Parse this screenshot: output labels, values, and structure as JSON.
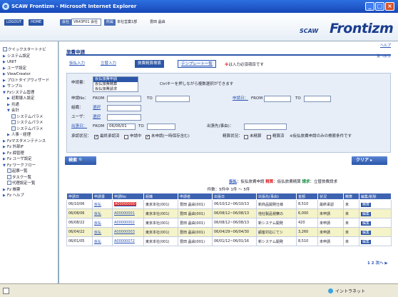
{
  "window": {
    "title": "SCAW Frontizm - Microsoft Internet Explorer",
    "controls": {
      "minimize": "_",
      "maximize": "□",
      "close": "×"
    }
  },
  "app_header": {
    "logo_small": "SCAW",
    "logo_big": "Frontizm",
    "buttons": [
      "LOGOUT",
      "HOME"
    ],
    "company_label": "会社",
    "company_value": "VR43F01 会社",
    "user_tag": "所属",
    "user_text": "本社営業1部",
    "user_name": "豊田 晶由"
  },
  "sidebar": {
    "items": [
      {
        "label": "クイックスタートナビ",
        "level": 1,
        "icon": "doc"
      },
      {
        "label": "システム設定",
        "level": 1,
        "icon": "tri"
      },
      {
        "label": "UNIT",
        "level": 1,
        "icon": "tri"
      },
      {
        "label": "ユーザ設定",
        "level": 1,
        "icon": "tri"
      },
      {
        "label": "ViewCreator",
        "level": 1,
        "icon": "tri"
      },
      {
        "label": "プロトタイプウィザード",
        "level": 1,
        "icon": "tri"
      },
      {
        "label": "サンプル",
        "level": 1,
        "icon": "tri"
      },
      {
        "label": "Fzシステム管理",
        "level": 1,
        "icon": "tri-open"
      },
      {
        "label": "初期導入設定",
        "level": 2,
        "icon": "tri"
      },
      {
        "label": "共通",
        "level": 2,
        "icon": "tri"
      },
      {
        "label": "会計",
        "level": 2,
        "icon": "tri-open"
      },
      {
        "label": "システムパラメ",
        "level": 3,
        "icon": "doc"
      },
      {
        "label": "システムパラメ",
        "level": 3,
        "icon": "doc"
      },
      {
        "label": "システムパラメ",
        "level": 3,
        "icon": "doc"
      },
      {
        "label": "人事・経理",
        "level": 2,
        "icon": "tri"
      },
      {
        "label": "Fzマスタメンテナンス",
        "level": 1,
        "icon": "tri"
      },
      {
        "label": "Fz 外部IF",
        "level": 1,
        "icon": "tri"
      },
      {
        "label": "Fz 締管理",
        "level": 1,
        "icon": "tri"
      },
      {
        "label": "Fz ユーザ設定",
        "level": 1,
        "icon": "tri"
      },
      {
        "label": "Fz ワークフロー",
        "level": 1,
        "icon": "tri-open"
      },
      {
        "label": "起票一覧",
        "level": 2,
        "icon": "doc"
      },
      {
        "label": "タスク一覧",
        "level": 2,
        "icon": "doc"
      },
      {
        "label": "代理設定一覧",
        "level": 2,
        "icon": "doc"
      },
      {
        "label": "Fz 帳票",
        "level": 1,
        "icon": "tri"
      },
      {
        "label": "Fz ヘルプ",
        "level": 1,
        "icon": "tri"
      }
    ]
  },
  "main": {
    "title": "旅費申請",
    "help_link": "ヘルプ",
    "back_link": "一覧へ戻る",
    "tabs": [
      "仮払入力",
      "立替入力",
      "旅費精算検索",
      "テンプレート一覧"
    ],
    "required_note_mark": "※",
    "required_note": "は入力必須項目です",
    "form": {
      "kind_label": "申請書：",
      "kind_options": [
        "仮払旅費申請",
        "仮払旅費精算",
        "仮払旅費請求"
      ],
      "kind_hint": "Ctrlキーを押しながら複数選択ができます",
      "no_label": "申請No：",
      "date_label": "申請日：",
      "from": "FROM",
      "to": "TO",
      "dept_label": "組織：",
      "user_label": "ユーザ：",
      "trip_label": "出張日：",
      "trip_from_value": "06/06/01",
      "purpose_label": "出張先(事由)：",
      "status_label": "承認状況：",
      "status_options": [
        "最終承認済",
        "申請中",
        "未申請(一時保存含む)"
      ],
      "settle_label": "精算状況：",
      "settle_options": [
        "未精算",
        "精算済"
      ],
      "settle_note": "※仮払旅費申請のみの検索条件です",
      "link_btn": "選択"
    },
    "search_button": "検索",
    "clear_button": "クリア",
    "legend": {
      "k1": "仮払",
      "t1": "：仮払旅費申請 ",
      "k2": "精算",
      "t2": "：仮払旅費精算 ",
      "k3": "請求",
      "t3": "：立替旅費請求"
    },
    "count": "件数：5件中 1件 ～ 5件",
    "table": {
      "headers": [
        "申請日",
        "申請書",
        "申請No",
        "組織",
        "申請者",
        "出張日",
        "出張先(事由)",
        "金額",
        "状況",
        "精算",
        "編集/削除"
      ],
      "rows": [
        [
          "06/10/06",
          "仮払",
          "A00000000",
          "東京本社(001)",
          "豊田 晶由(001)",
          "06/10/12~06/10/13",
          "新商品開発仕様",
          "8,510",
          "最終承認",
          "未",
          "精算"
        ],
        [
          "06/08/06",
          "仮払",
          "A00000001",
          "東京本社(001)",
          "豊田 晶由(001)",
          "06/08/12~06/08/13",
          "他社製品視察の",
          "6,000",
          "未申請",
          "未",
          "編集"
        ],
        [
          "06/08/22",
          "仮払",
          "A00000002",
          "東京本社(001)",
          "豊田 晶由(001)",
          "06/08/12~06/08/13",
          "新システム開発",
          "420",
          "未申請",
          "未",
          "編集"
        ],
        [
          "06/04/22",
          "仮払",
          "A00000003",
          "東京本社(001)",
          "豊田 晶由(001)",
          "06/04/29~06/04/30",
          "顧客対応にてシ",
          "3,260",
          "未申請",
          "未",
          "編集"
        ],
        [
          "06/01/05",
          "仮払",
          "A00000072",
          "東京本社(001)",
          "豊田 晶由(001)",
          "06/01/12~06/01/16",
          "新システム開発",
          "8,510",
          "未申請",
          "未",
          "編集"
        ]
      ]
    },
    "pager": "1 2 次へ ▶"
  },
  "statusbar": {
    "zone": "イントラネット"
  }
}
